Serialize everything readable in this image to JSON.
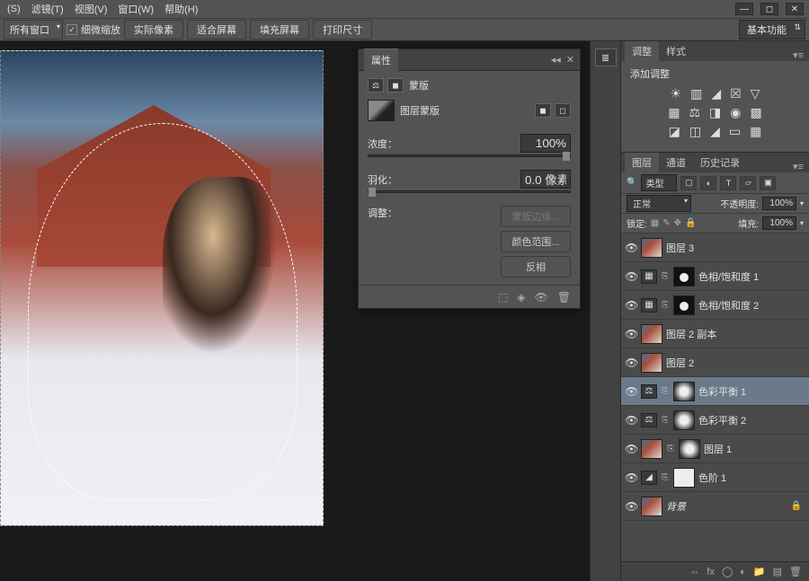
{
  "menu": {
    "s": "(S)",
    "filter": "滤镜(T)",
    "view": "视图(V)",
    "window": "窗口(W)",
    "help": "帮助(H)"
  },
  "options": {
    "all_windows": "所有窗口",
    "scrubby_zoom": "细微缩放",
    "actual_pixels": "实际像素",
    "fit_screen": "适合屏幕",
    "fill_screen": "填充屏幕",
    "print_size": "打印尺寸",
    "workspace": "基本功能"
  },
  "properties": {
    "title": "属性",
    "mask_label": "蒙版",
    "layer_mask": "图层蒙版",
    "density_label": "浓度：",
    "density_value": "100%",
    "feather_label": "羽化：",
    "feather_value": "0.0 像素",
    "adjust_label": "调整：",
    "btn_mask_edge": "蒙版边缘...",
    "btn_color_range": "颜色范围...",
    "btn_invert": "反相"
  },
  "adjustments": {
    "tab1": "调整",
    "tab2": "样式",
    "add_label": "添加调整"
  },
  "layers_panel": {
    "tab1": "图层",
    "tab2": "通道",
    "tab3": "历史记录",
    "filter_kind": "类型",
    "blend_mode": "正常",
    "opacity_label": "不透明度:",
    "opacity_value": "100%",
    "lock_label": "锁定:",
    "fill_label": "填充:",
    "fill_value": "100%"
  },
  "layers": [
    {
      "name": "图层 3",
      "type": "image"
    },
    {
      "name": "色相/饱和度 1",
      "type": "adj-hue",
      "mask": "dark"
    },
    {
      "name": "色相/饱和度 2",
      "type": "adj-hue",
      "mask": "dark"
    },
    {
      "name": "图层 2 副本",
      "type": "image"
    },
    {
      "name": "图层 2",
      "type": "image"
    },
    {
      "name": "色彩平衡 1",
      "type": "adj-bal",
      "mask": "blur",
      "selected": true
    },
    {
      "name": "色彩平衡 2",
      "type": "adj-bal",
      "mask": "blur"
    },
    {
      "name": "图层 1",
      "type": "image-mask",
      "mask": "blur"
    },
    {
      "name": "色阶 1",
      "type": "adj-lvl",
      "mask": "white"
    },
    {
      "name": "背景",
      "type": "image",
      "locked": true,
      "italic": true
    }
  ]
}
